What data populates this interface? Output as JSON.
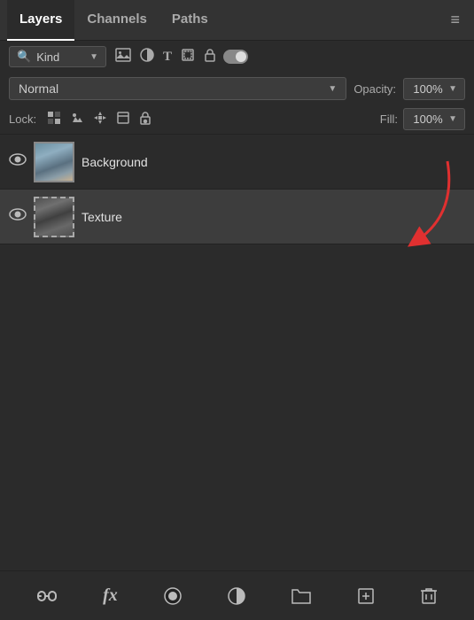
{
  "tabs": {
    "items": [
      {
        "id": "layers",
        "label": "Layers",
        "active": true
      },
      {
        "id": "channels",
        "label": "Channels",
        "active": false
      },
      {
        "id": "paths",
        "label": "Paths",
        "active": false
      }
    ],
    "menu_icon": "≡"
  },
  "filter_row": {
    "search_icon": "🔍",
    "kind_label": "Kind",
    "chevron": "▼",
    "icons": {
      "image": "🖼",
      "circle": "◑",
      "text": "T",
      "transform": "⬚",
      "lock": "🔒"
    },
    "toggle_state": "on"
  },
  "blend_row": {
    "blend_label": "Normal",
    "blend_chevron": "▼",
    "opacity_label": "Opacity:",
    "opacity_value": "100%",
    "opacity_chevron": "▼"
  },
  "lock_row": {
    "lock_label": "Lock:",
    "lock_icons": {
      "checkerboard": "⊞",
      "brush": "✏",
      "move": "✛",
      "crop": "⊟",
      "padlock": "🔒"
    },
    "fill_label": "Fill:",
    "fill_value": "100%",
    "fill_chevron": "▼"
  },
  "layers": [
    {
      "id": "background",
      "name": "Background",
      "visible": true,
      "selected": false,
      "thumb_type": "background"
    },
    {
      "id": "texture",
      "name": "Texture",
      "visible": true,
      "selected": true,
      "thumb_type": "texture",
      "dashed": true
    }
  ],
  "bottom_toolbar": {
    "link_icon": "🔗",
    "fx_label": "fx",
    "circle_icon": "⬤",
    "half_circle": "◑",
    "folder_icon": "📁",
    "add_icon": "⊞",
    "trash_icon": "🗑"
  }
}
